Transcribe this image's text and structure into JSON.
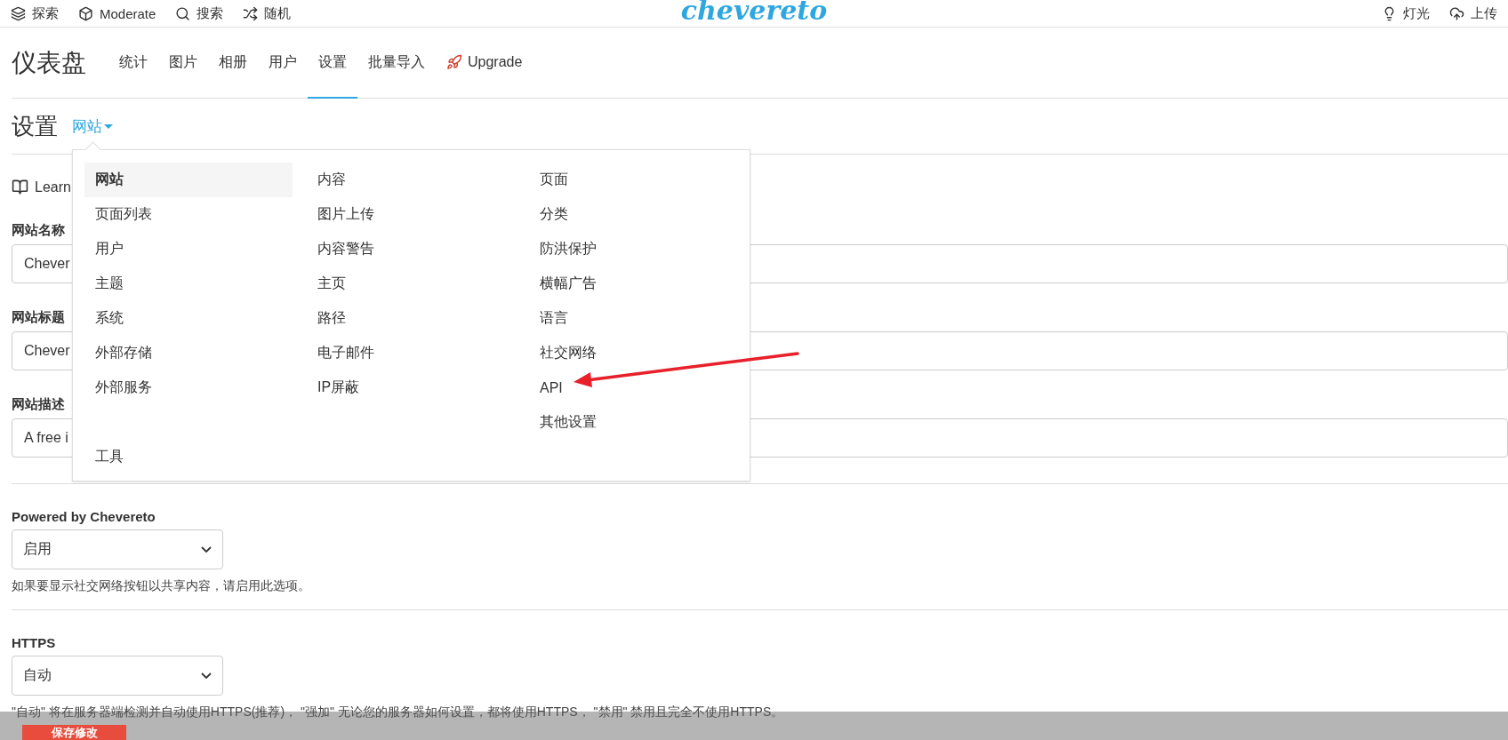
{
  "top_bar": {
    "left": [
      {
        "kind": "layers",
        "label": "探索"
      },
      {
        "kind": "cube",
        "label": "Moderate"
      },
      {
        "kind": "search",
        "label": "搜索"
      },
      {
        "kind": "shuffle",
        "label": "随机"
      }
    ],
    "logo": "chevereto",
    "right": [
      {
        "kind": "bulb",
        "label": "灯光"
      },
      {
        "kind": "upload",
        "label": "上传"
      }
    ]
  },
  "dashboard": {
    "title": "仪表盘",
    "tabs": [
      {
        "label": "统计",
        "selected": false,
        "kind": "text"
      },
      {
        "label": "图片",
        "selected": false,
        "kind": "text"
      },
      {
        "label": "相册",
        "selected": false,
        "kind": "text"
      },
      {
        "label": "用户",
        "selected": false,
        "kind": "text"
      },
      {
        "label": "设置",
        "selected": true,
        "kind": "text"
      },
      {
        "label": "批量导入",
        "selected": false,
        "kind": "text"
      },
      {
        "label": "Upgrade",
        "selected": false,
        "kind": "rocket"
      }
    ]
  },
  "settings": {
    "title": "设置",
    "section": "网站"
  },
  "learn": "Learn",
  "fields": [
    {
      "label": "网站名称",
      "value": "Chever"
    },
    {
      "label": "网站标题",
      "value": "Chever"
    },
    {
      "label": "网站描述",
      "value": "A free i"
    }
  ],
  "selects": [
    {
      "label": "Powered by Chevereto",
      "value": "启用",
      "help": "如果要显示社交网络按钮以共享内容，请启用此选项。"
    },
    {
      "label": "HTTPS",
      "value": "自动",
      "help": "\"自动\" 将在服务器端检测并自动使用HTTPS(推荐)，  \"强加\" 无论您的服务器如何设置，都将使用HTTPS，  \"禁用\" 禁用且完全不使用HTTPS。"
    }
  ],
  "save_button": "保存修改",
  "menu": {
    "columns": [
      [
        {
          "label": "网站",
          "selected": true
        },
        {
          "label": "页面列表",
          "selected": false
        },
        {
          "label": "用户",
          "selected": false
        },
        {
          "label": "主题",
          "selected": false
        },
        {
          "label": "系统",
          "selected": false
        },
        {
          "label": "外部存储",
          "selected": false
        },
        {
          "label": "外部服务",
          "selected": false
        }
      ],
      [
        {
          "label": "内容",
          "selected": false
        },
        {
          "label": "图片上传",
          "selected": false
        },
        {
          "label": "内容警告",
          "selected": false
        },
        {
          "label": "主页",
          "selected": false
        },
        {
          "label": "路径",
          "selected": false
        },
        {
          "label": "电子邮件",
          "selected": false
        },
        {
          "label": "IP屏蔽",
          "selected": false
        }
      ],
      [
        {
          "label": "页面",
          "selected": false
        },
        {
          "label": "分类",
          "selected": false
        },
        {
          "label": "防洪保护",
          "selected": false
        },
        {
          "label": "横幅广告",
          "selected": false
        },
        {
          "label": "语言",
          "selected": false
        },
        {
          "label": "社交网络",
          "selected": false
        },
        {
          "label": "API",
          "selected": false
        },
        {
          "label": "其他设置",
          "selected": false
        }
      ]
    ],
    "footer_items": [
      {
        "label": "工具",
        "selected": false
      }
    ]
  }
}
